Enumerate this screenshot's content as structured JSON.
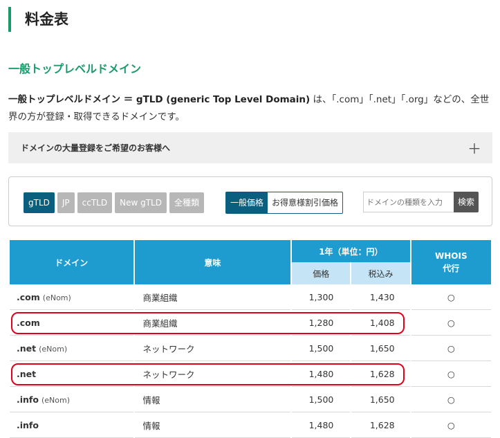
{
  "page": {
    "title": "料金表",
    "section_heading": "一般トップレベルドメイン",
    "intro_bold": "一般トップレベルドメイン ＝ gTLD (generic Top Level Domain)",
    "intro_rest": " は、「.com」「.net」「.org」などの、全世界の方が登録・取得できるドメインです。"
  },
  "accordion": {
    "label": "ドメインの大量登録をご希望のお客様へ",
    "toggle": "＋"
  },
  "filters": {
    "tld_tabs": [
      "gTLD",
      "JP",
      "ccTLD",
      "New gTLD",
      "全種類"
    ],
    "active_tab": "gTLD",
    "price_modes": [
      "一般価格",
      "お得意様割引価格"
    ],
    "active_price_mode": "一般価格",
    "search_placeholder": "ドメインの種類を入力",
    "search_button": "検索"
  },
  "table": {
    "headers": {
      "domain": "ドメイン",
      "meaning": "意味",
      "year": "1年（単位：円）",
      "price": "価格",
      "tax": "税込み",
      "whois": "WHOIS\n代行"
    },
    "rows": [
      {
        "domain": ".com",
        "registrar": "(eNom)",
        "meaning": "商業組織",
        "price": "1,300",
        "tax": "1,430",
        "whois": "○",
        "highlighted": false
      },
      {
        "domain": ".com",
        "registrar": "",
        "meaning": "商業組織",
        "price": "1,280",
        "tax": "1,408",
        "whois": "○",
        "highlighted": true
      },
      {
        "domain": ".net",
        "registrar": "(eNom)",
        "meaning": "ネットワーク",
        "price": "1,500",
        "tax": "1,650",
        "whois": "○",
        "highlighted": false
      },
      {
        "domain": ".net",
        "registrar": "",
        "meaning": "ネットワーク",
        "price": "1,480",
        "tax": "1,628",
        "whois": "○",
        "highlighted": true
      },
      {
        "domain": ".info",
        "registrar": "(eNom)",
        "meaning": "情報",
        "price": "1,500",
        "tax": "1,650",
        "whois": "○",
        "highlighted": false
      },
      {
        "domain": ".info",
        "registrar": "",
        "meaning": "情報",
        "price": "1,480",
        "tax": "1,628",
        "whois": "○",
        "highlighted": false
      }
    ]
  },
  "colors": {
    "accent_green": "#1a9a6a",
    "header_blue": "#1e9cd0",
    "subheader_blue": "#c5e4f6",
    "active_dark": "#0a5f7e",
    "highlight_red": "#e0001b"
  }
}
